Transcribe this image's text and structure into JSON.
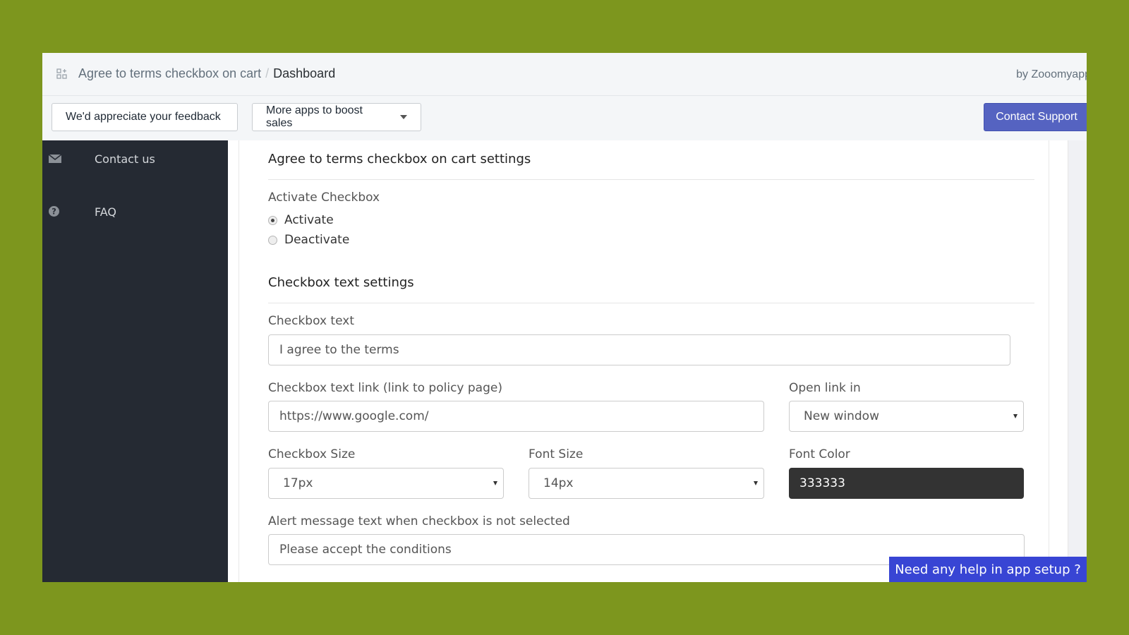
{
  "header": {
    "breadcrumb_app": "Agree to terms checkbox on cart",
    "breadcrumb_separator": "/",
    "breadcrumb_current": "Dashboard",
    "byline": "by Zooomyapps"
  },
  "toolbar": {
    "feedback_label": "We'd appreciate your feedback",
    "more_apps_label": "More apps to boost sales",
    "contact_support_label": "Contact Support"
  },
  "sidebar": {
    "items": [
      {
        "label": "Contact us",
        "icon": "envelope-icon"
      },
      {
        "label": "FAQ",
        "icon": "question-circle-icon"
      }
    ]
  },
  "settings": {
    "title": "Agree to terms checkbox on cart settings",
    "activate": {
      "label": "Activate Checkbox",
      "options": [
        {
          "label": "Activate",
          "selected": true
        },
        {
          "label": "Deactivate",
          "selected": false
        }
      ]
    },
    "text_section_title": "Checkbox text settings",
    "checkbox_text": {
      "label": "Checkbox text",
      "value": "I agree to the terms"
    },
    "checkbox_link": {
      "label": "Checkbox text link (link to policy page)",
      "value": "https://www.google.com/"
    },
    "open_link_in": {
      "label": "Open link in",
      "value": "New window"
    },
    "checkbox_size": {
      "label": "Checkbox Size",
      "value": "17px"
    },
    "font_size": {
      "label": "Font Size",
      "value": "14px"
    },
    "font_color": {
      "label": "Font Color",
      "value": "333333",
      "color": "#333333"
    },
    "alert_message": {
      "label": "Alert message text when checkbox is not selected",
      "value": "Please accept the conditions"
    }
  },
  "help": {
    "label": "Need any help in app setup ?"
  },
  "colors": {
    "background": "#7d961e",
    "sidebar": "#252a33",
    "accent": "#5563c1",
    "help_button": "#3845d4"
  }
}
